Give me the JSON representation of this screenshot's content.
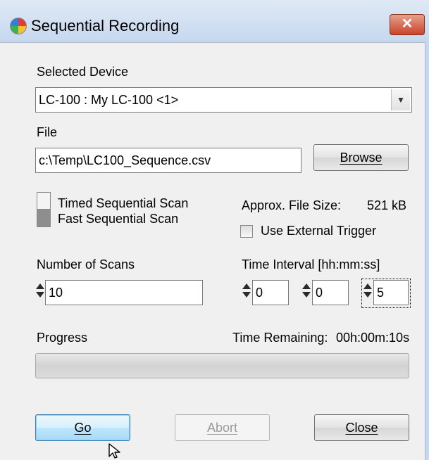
{
  "window": {
    "title": "Sequential Recording",
    "close_glyph": "✕",
    "app_icon": "color-wheel-icon"
  },
  "device": {
    "label": "Selected Device",
    "value": "LC-100 : My LC-100 <1>"
  },
  "file": {
    "label": "File",
    "value": "c:\\Temp\\LC100_Sequence.csv",
    "browse_label": "Browse"
  },
  "scan_mode": {
    "options": [
      "Timed Sequential Scan",
      "Fast Sequential Scan"
    ],
    "selected": "Fast Sequential Scan"
  },
  "file_size": {
    "label": "Approx. File Size:",
    "value": "521 kB"
  },
  "external_trigger": {
    "label": "Use External Trigger",
    "checked": false
  },
  "scans": {
    "label": "Number of Scans",
    "value": "10"
  },
  "interval": {
    "label": "Time Interval [hh:mm:ss]",
    "hh": "0",
    "mm": "0",
    "ss": "5"
  },
  "progress": {
    "label": "Progress",
    "remaining_label": "Time Remaining:",
    "remaining_value": "00h:00m:10s",
    "fraction": 0
  },
  "buttons": {
    "go": "Go",
    "abort": "Abort",
    "close": "Close"
  },
  "colors": {
    "titlebar": "#c6d8ee",
    "close": "#c8442b",
    "go_button": "#bee6fd",
    "progress_fill": "#06b025"
  }
}
